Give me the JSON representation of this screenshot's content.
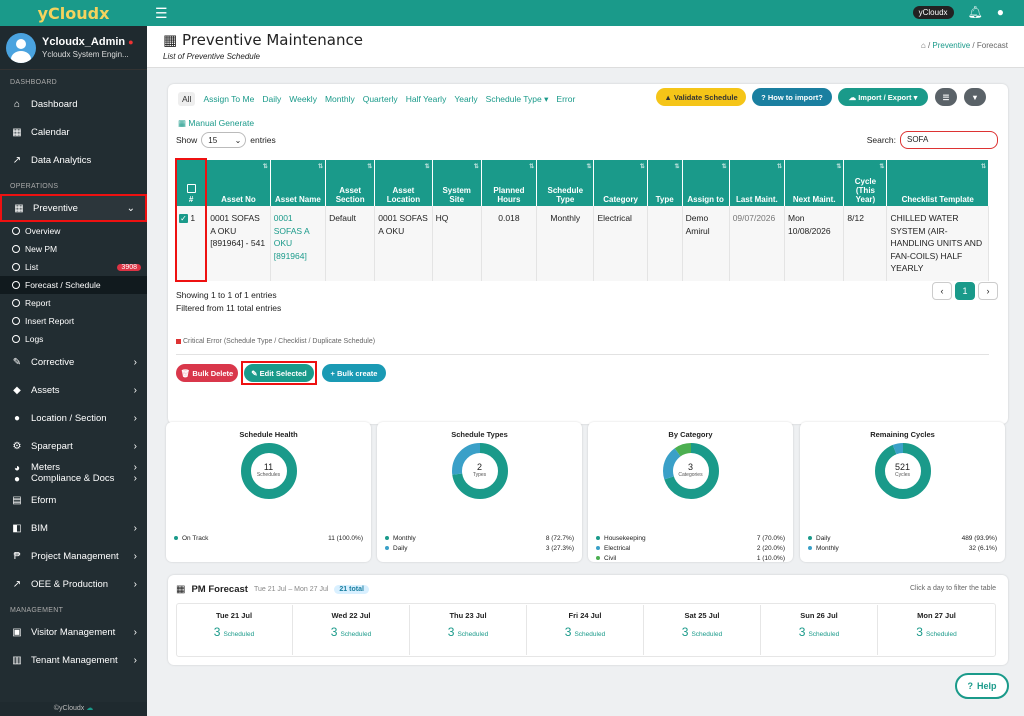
{
  "app": {
    "brand": "yCloudx",
    "user_pill": "yCloudx"
  },
  "user": {
    "name": "Ycloudx_Admin",
    "role": "Ycloudx System Engin..."
  },
  "sidebar": {
    "sections": {
      "dashboard": "DASHBOARD",
      "operations": "OPERATIONS",
      "management": "MANAGEMENT"
    },
    "dashboard": [
      {
        "label": "Dashboard",
        "icon": "home-icon"
      },
      {
        "label": "Calendar",
        "icon": "calendar-icon"
      },
      {
        "label": "Data Analytics",
        "icon": "chart-icon"
      }
    ],
    "preventive": {
      "label": "Preventive"
    },
    "sub": [
      {
        "label": "Overview"
      },
      {
        "label": "New PM"
      },
      {
        "label": "List",
        "badge": "3908"
      },
      {
        "label": "Forecast / Schedule"
      },
      {
        "label": "Report"
      },
      {
        "label": "Insert Report"
      },
      {
        "label": "Logs"
      }
    ],
    "ops": [
      {
        "label": "Corrective"
      },
      {
        "label": "Assets"
      },
      {
        "label": "Location / Section"
      },
      {
        "label": "Sparepart"
      },
      {
        "label": "Meters"
      },
      {
        "label": "Compliance & Docs"
      },
      {
        "label": "Eform"
      },
      {
        "label": "BIM"
      },
      {
        "label": "Project Management"
      },
      {
        "label": "OEE & Production"
      }
    ],
    "mgmt": [
      {
        "label": "Visitor Management"
      },
      {
        "label": "Tenant Management"
      }
    ],
    "footer": "©yCloudx"
  },
  "page": {
    "title": "Preventive Maintenance",
    "subtitle": "List of Preventive Schedule",
    "crumb_link": "Preventive",
    "crumb_current": "Forecast"
  },
  "tabs": [
    "All",
    "Assign To Me",
    "Daily",
    "Weekly",
    "Monthly",
    "Quarterly",
    "Half Yearly",
    "Yearly",
    "Schedule Type",
    "Error"
  ],
  "buttons": {
    "validate": "Validate Schedule",
    "howto": "How to import?",
    "import": "Import / Export",
    "manual": "Manual Generate",
    "bulk_delete": "Bulk Delete",
    "edit_selected": "Edit Selected",
    "bulk_create": "Bulk create"
  },
  "table": {
    "show_label": "Show",
    "entries_label": "entries",
    "page_size": "15",
    "search_label": "Search:",
    "search_value": "SOFA",
    "headers": [
      "#",
      "Asset No",
      "Asset Name",
      "Asset Section",
      "Asset Location",
      "System Site",
      "Planned Hours",
      "Schedule Type",
      "Category",
      "Type",
      "Assign to",
      "Last Maint.",
      "Next Maint.",
      "Cycle (This Year)",
      "Checklist Template"
    ],
    "row": {
      "num": "1",
      "asset_no": "0001 SOFAS A OKU [891964] - 541",
      "asset_name": "0001 SOFAS A OKU [891964]",
      "section": "Default",
      "location": "0001 SOFAS A OKU",
      "site": "HQ",
      "hours": "0.018",
      "schedule": "Monthly",
      "category": "Electrical",
      "type": "",
      "assign": "Demo Amirul",
      "last": "09/07/2026",
      "next": "Mon 10/08/2026",
      "cycle": "8/12",
      "checklist": "CHILLED WATER SYSTEM (AIR-HANDLING UNITS AND FAN-COILS) HALF YEARLY"
    },
    "showing": "Showing 1 to 1 of 1 entries",
    "filtered": "Filtered from 11 total entries",
    "page": "1",
    "critical": "Critical Error (Schedule Type / Checklist / Duplicate Schedule)"
  },
  "stats": [
    {
      "title": "Schedule Health",
      "count": "11",
      "unit": "Schedules",
      "legend": [
        {
          "label": "On Track",
          "value": "11 (100.0%)",
          "color": "#1a9a8a"
        }
      ],
      "slices": [
        1
      ]
    },
    {
      "title": "Schedule Types",
      "count": "2",
      "unit": "Types",
      "legend": [
        {
          "label": "Monthly",
          "value": "8 (72.7%)",
          "color": "#1a9a8a"
        },
        {
          "label": "Daily",
          "value": "3 (27.3%)",
          "color": "#3aa0c8"
        }
      ],
      "slices": [
        0.727,
        0.273
      ]
    },
    {
      "title": "By Category",
      "count": "3",
      "unit": "Categories",
      "legend": [
        {
          "label": "Housekeeping",
          "value": "7 (70.0%)",
          "color": "#1a9a8a"
        },
        {
          "label": "Electrical",
          "value": "2 (20.0%)",
          "color": "#3aa0c8"
        },
        {
          "label": "Civil",
          "value": "1 (10.0%)",
          "color": "#4caf50"
        }
      ],
      "slices": [
        0.7,
        0.2,
        0.1
      ]
    },
    {
      "title": "Remaining Cycles",
      "count": "521",
      "unit": "Cycles",
      "legend": [
        {
          "label": "Daily",
          "value": "489 (93.9%)",
          "color": "#1a9a8a"
        },
        {
          "label": "Monthly",
          "value": "32 (6.1%)",
          "color": "#3aa0c8"
        }
      ],
      "slices": [
        0.939,
        0.061
      ]
    }
  ],
  "forecast": {
    "title": "PM Forecast",
    "range": "Tue 21 Jul – Mon 27 Jul",
    "total": "21 total",
    "hint": "Click a day to filter the table",
    "scheduled": "Scheduled",
    "days": [
      {
        "d": "Tue 21 Jul",
        "n": "3"
      },
      {
        "d": "Wed 22 Jul",
        "n": "3"
      },
      {
        "d": "Thu 23 Jul",
        "n": "3"
      },
      {
        "d": "Fri 24 Jul",
        "n": "3"
      },
      {
        "d": "Sat 25 Jul",
        "n": "3"
      },
      {
        "d": "Sun 26 Jul",
        "n": "3"
      },
      {
        "d": "Mon 27 Jul",
        "n": "3"
      }
    ]
  },
  "help": "Help"
}
